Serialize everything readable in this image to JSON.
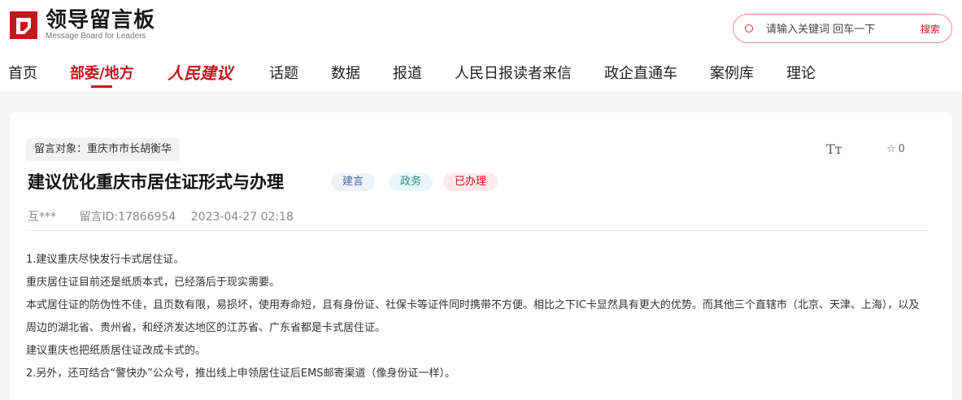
{
  "header": {
    "logo_title": "领导留言板",
    "logo_subtitle": "Message Board for Leaders",
    "search_placeholder": "请输入关键词 回车一下",
    "search_button": "搜索"
  },
  "nav": {
    "items": [
      "首页",
      "部委/地方",
      "人民建议",
      "话题",
      "数据",
      "报道",
      "人民日报读者来信",
      "政企直通车",
      "案例库",
      "理论"
    ],
    "active": "部委/地方"
  },
  "post": {
    "target": "留言对象：重庆市市长胡衡华",
    "font_toggle": "Tт",
    "fav_count": "0",
    "title": "建议优化重庆市居住证形式与办理",
    "tags": [
      "建言",
      "政务",
      "已办理"
    ],
    "author": "互***",
    "id": "留言ID:17866954",
    "time": "2023-04-27 02:18",
    "paragraphs": [
      "1.建议重庆尽快发行卡式居住证。",
      "重庆居住证目前还是纸质本式，已经落后于现实需要。",
      "本式居住证的防伪性不佳，且页数有限，易损坏，使用寿命短，且有身份证、社保卡等证件同时携带不方便。相比之下IC卡显然具有更大的优势。而其他三个直辖市（北京、天津、上海），以及周边的湖北省、贵州省，和经济发达地区的江苏省、广东省都是卡式居住证。",
      "建议重庆也把纸质居住证改成卡式的。",
      "2.另外，还可结合“警快办”公众号，推出线上申领居住证后EMS邮寄渠道（像身份证一样）。"
    ]
  },
  "colors": {
    "accent": "#c8161d"
  }
}
